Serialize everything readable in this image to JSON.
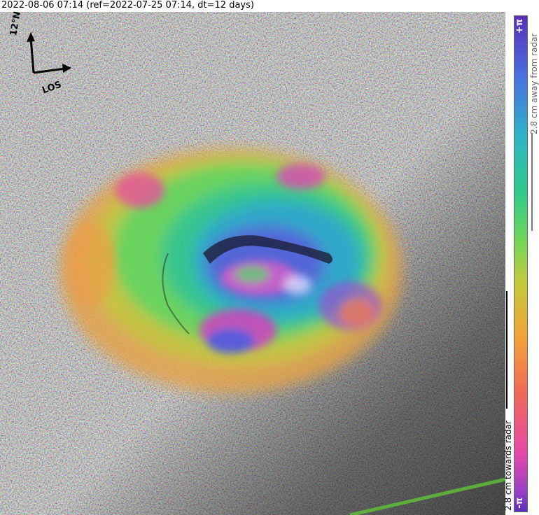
{
  "title": "2022-08-06 07:14 (ref=2022-07-25 07:14, dt=12 days)",
  "compass": {
    "north_label": "12°N",
    "los_label": "LOS"
  },
  "colorbar": {
    "top_label": "+π",
    "bottom_label": "-π",
    "away_label": "2.8 cm away from radar",
    "towards_label": "2.8 cm towards radar",
    "colors": [
      "#5b2fb8",
      "#4a6fe0",
      "#2fb3c8",
      "#33c98a",
      "#6fd65a",
      "#c6c93c",
      "#f1a33b",
      "#ef6a57",
      "#e64aa8",
      "#9a3fc4"
    ]
  }
}
